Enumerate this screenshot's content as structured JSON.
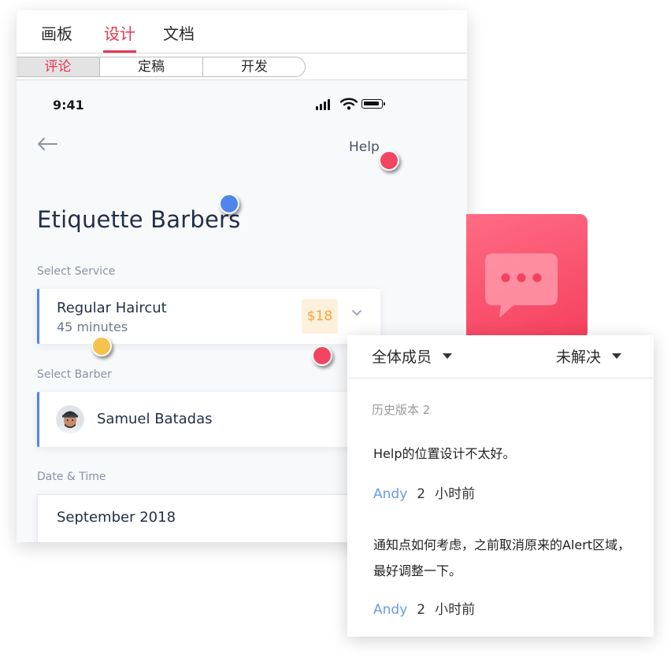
{
  "tabs": [
    "画板",
    "设计",
    "文档"
  ],
  "active_tab_index": 1,
  "segments": [
    "评论",
    "定稿",
    "开发"
  ],
  "active_segment_index": 0,
  "phone": {
    "status_time": "9:41",
    "help_label": "Help",
    "shop_title": "Etiquette Barbers",
    "service_label": "Select Service",
    "service_name": "Regular Haircut",
    "service_duration": "45 minutes",
    "service_price": "$18",
    "barber_label": "Select Barber",
    "barber_name": "Samuel Batadas",
    "date_label": "Date & Time",
    "date_value": "September 2018"
  },
  "comments_panel": {
    "filter_members": "全体成员",
    "filter_status": "未解决",
    "history_label": "历史版本 2",
    "comments": [
      {
        "text": "Help的位置设计不太好。",
        "author": "Andy",
        "count": "2",
        "time": "小时前"
      },
      {
        "text": "通知点如何考虑，之前取消原来的Alert区域，最好调整一下。",
        "author": "Andy",
        "count": "2",
        "time": "小时前"
      }
    ]
  },
  "colors": {
    "accent": "#e8354f",
    "pin_red": "#f14562",
    "pin_blue": "#4f86ec",
    "pin_yellow": "#f5c24d",
    "author_link": "#6a9ae6",
    "price_text": "#f3a63b"
  },
  "icons": [
    "back-arrow-icon",
    "signal-icon",
    "wifi-icon",
    "battery-icon",
    "chevron-down-icon",
    "chat-bubble-icon",
    "caret-down-icon"
  ]
}
